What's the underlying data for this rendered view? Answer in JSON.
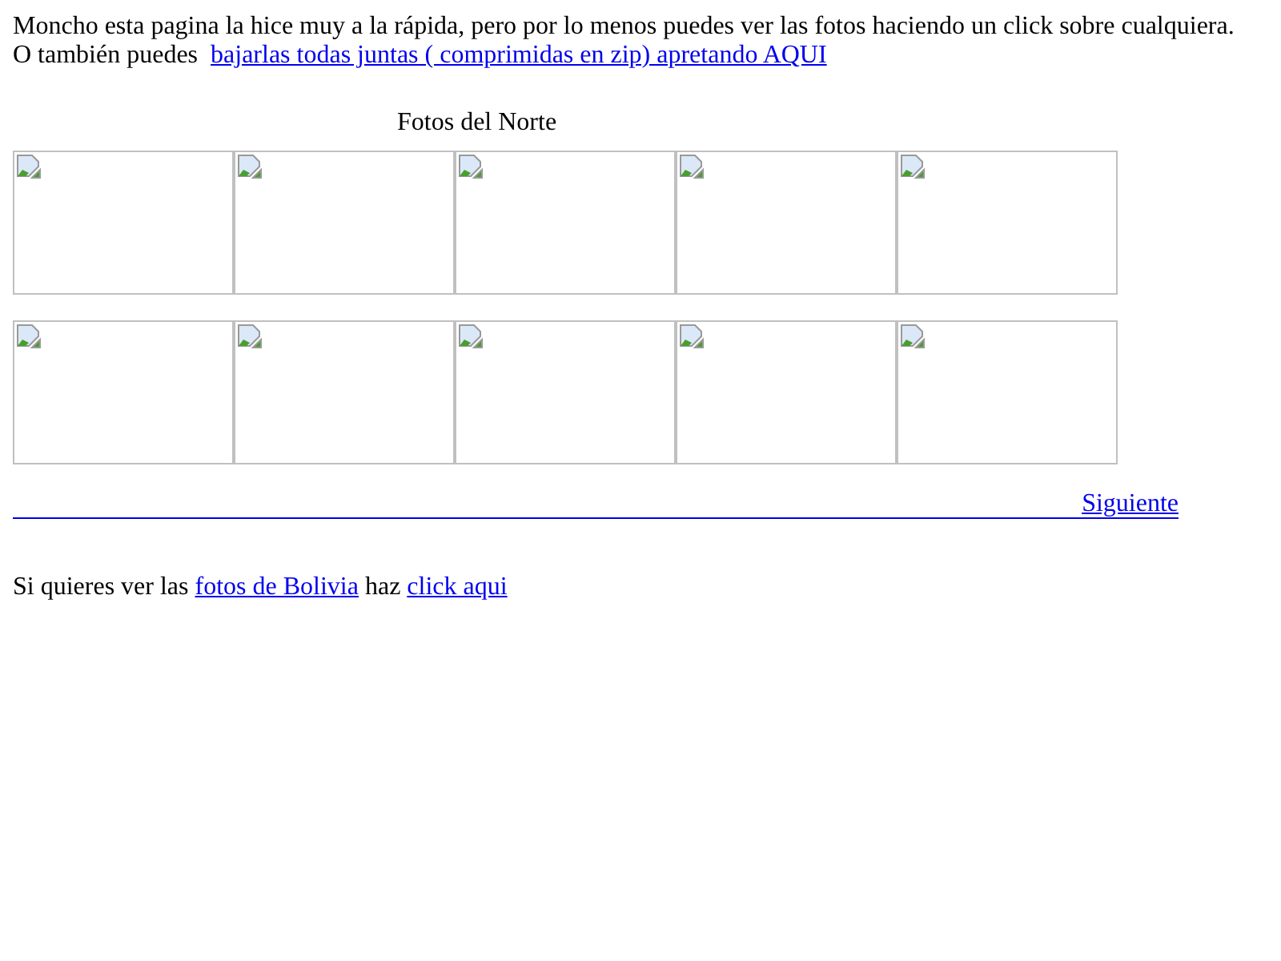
{
  "intro": {
    "text": "Moncho esta pagina la hice muy a la rápida, pero por lo menos puedes ver las fotos haciendo un click sobre cualquiera.",
    "prefix": "O también puedes",
    "link": "bajarlas todas juntas ( comprimidas en zip) apretando AQUI"
  },
  "gallery": {
    "title": "Fotos del Norte",
    "rows": [
      [
        {
          "kind": "broken_image"
        },
        {
          "kind": "broken_image"
        },
        {
          "kind": "broken_image"
        },
        {
          "kind": "broken_image"
        },
        {
          "kind": "broken_image"
        }
      ],
      [
        {
          "kind": "broken_image"
        },
        {
          "kind": "broken_image"
        },
        {
          "kind": "broken_image"
        },
        {
          "kind": "broken_image"
        },
        {
          "kind": "broken_image"
        }
      ]
    ],
    "next_link": "Siguiente"
  },
  "footer": {
    "before": "Si quieres ver las",
    "link1": "fotos de Bolivia",
    "middle": "haz",
    "link2": "click aqui"
  }
}
